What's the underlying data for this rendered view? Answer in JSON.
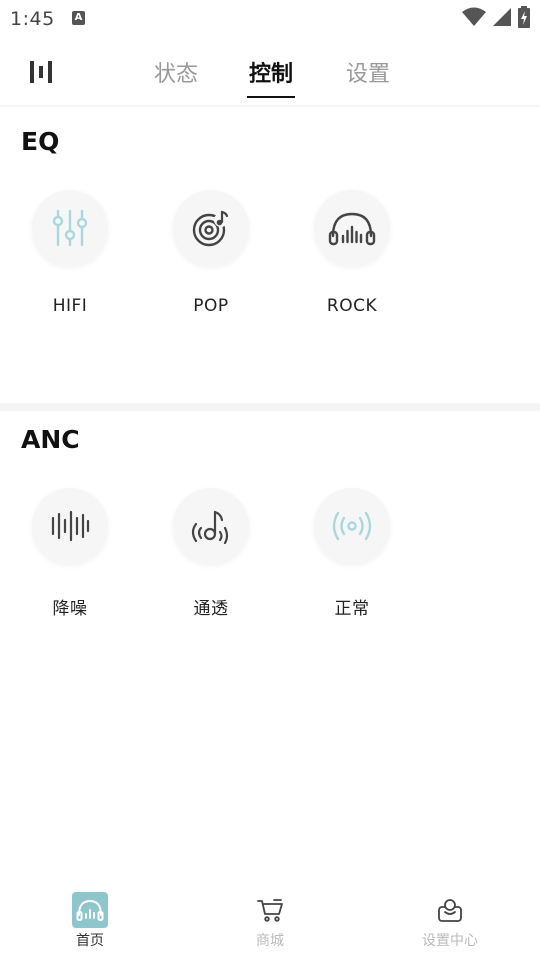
{
  "status_bar": {
    "time": "1:45",
    "notification_letter": "A",
    "icons": [
      "wifi-icon",
      "signal-icon",
      "battery-charging-icon"
    ]
  },
  "top_nav": {
    "tabs": [
      {
        "label": "状态",
        "active": false
      },
      {
        "label": "控制",
        "active": true
      },
      {
        "label": "设置",
        "active": false
      }
    ]
  },
  "eq": {
    "title": "EQ",
    "options": [
      {
        "label": "HIFI",
        "icon": "sliders-icon"
      },
      {
        "label": "POP",
        "icon": "vinyl-music-icon"
      },
      {
        "label": "ROCK",
        "icon": "headphones-icon"
      }
    ]
  },
  "anc": {
    "title": "ANC",
    "options": [
      {
        "label": "降噪",
        "icon": "waveform-icon"
      },
      {
        "label": "通透",
        "icon": "sound-note-icon"
      },
      {
        "label": "正常",
        "icon": "broadcast-icon"
      }
    ]
  },
  "bottom_nav": {
    "items": [
      {
        "label": "首页",
        "icon": "headphones-home-icon",
        "active": true
      },
      {
        "label": "商城",
        "icon": "cart-icon",
        "active": false
      },
      {
        "label": "设置中心",
        "icon": "user-settings-icon",
        "active": false
      }
    ]
  },
  "colors": {
    "accent": "#8fc6cc",
    "icon_dark": "#444444",
    "icon_light": "#a8d8de",
    "inactive_text": "#999999"
  }
}
